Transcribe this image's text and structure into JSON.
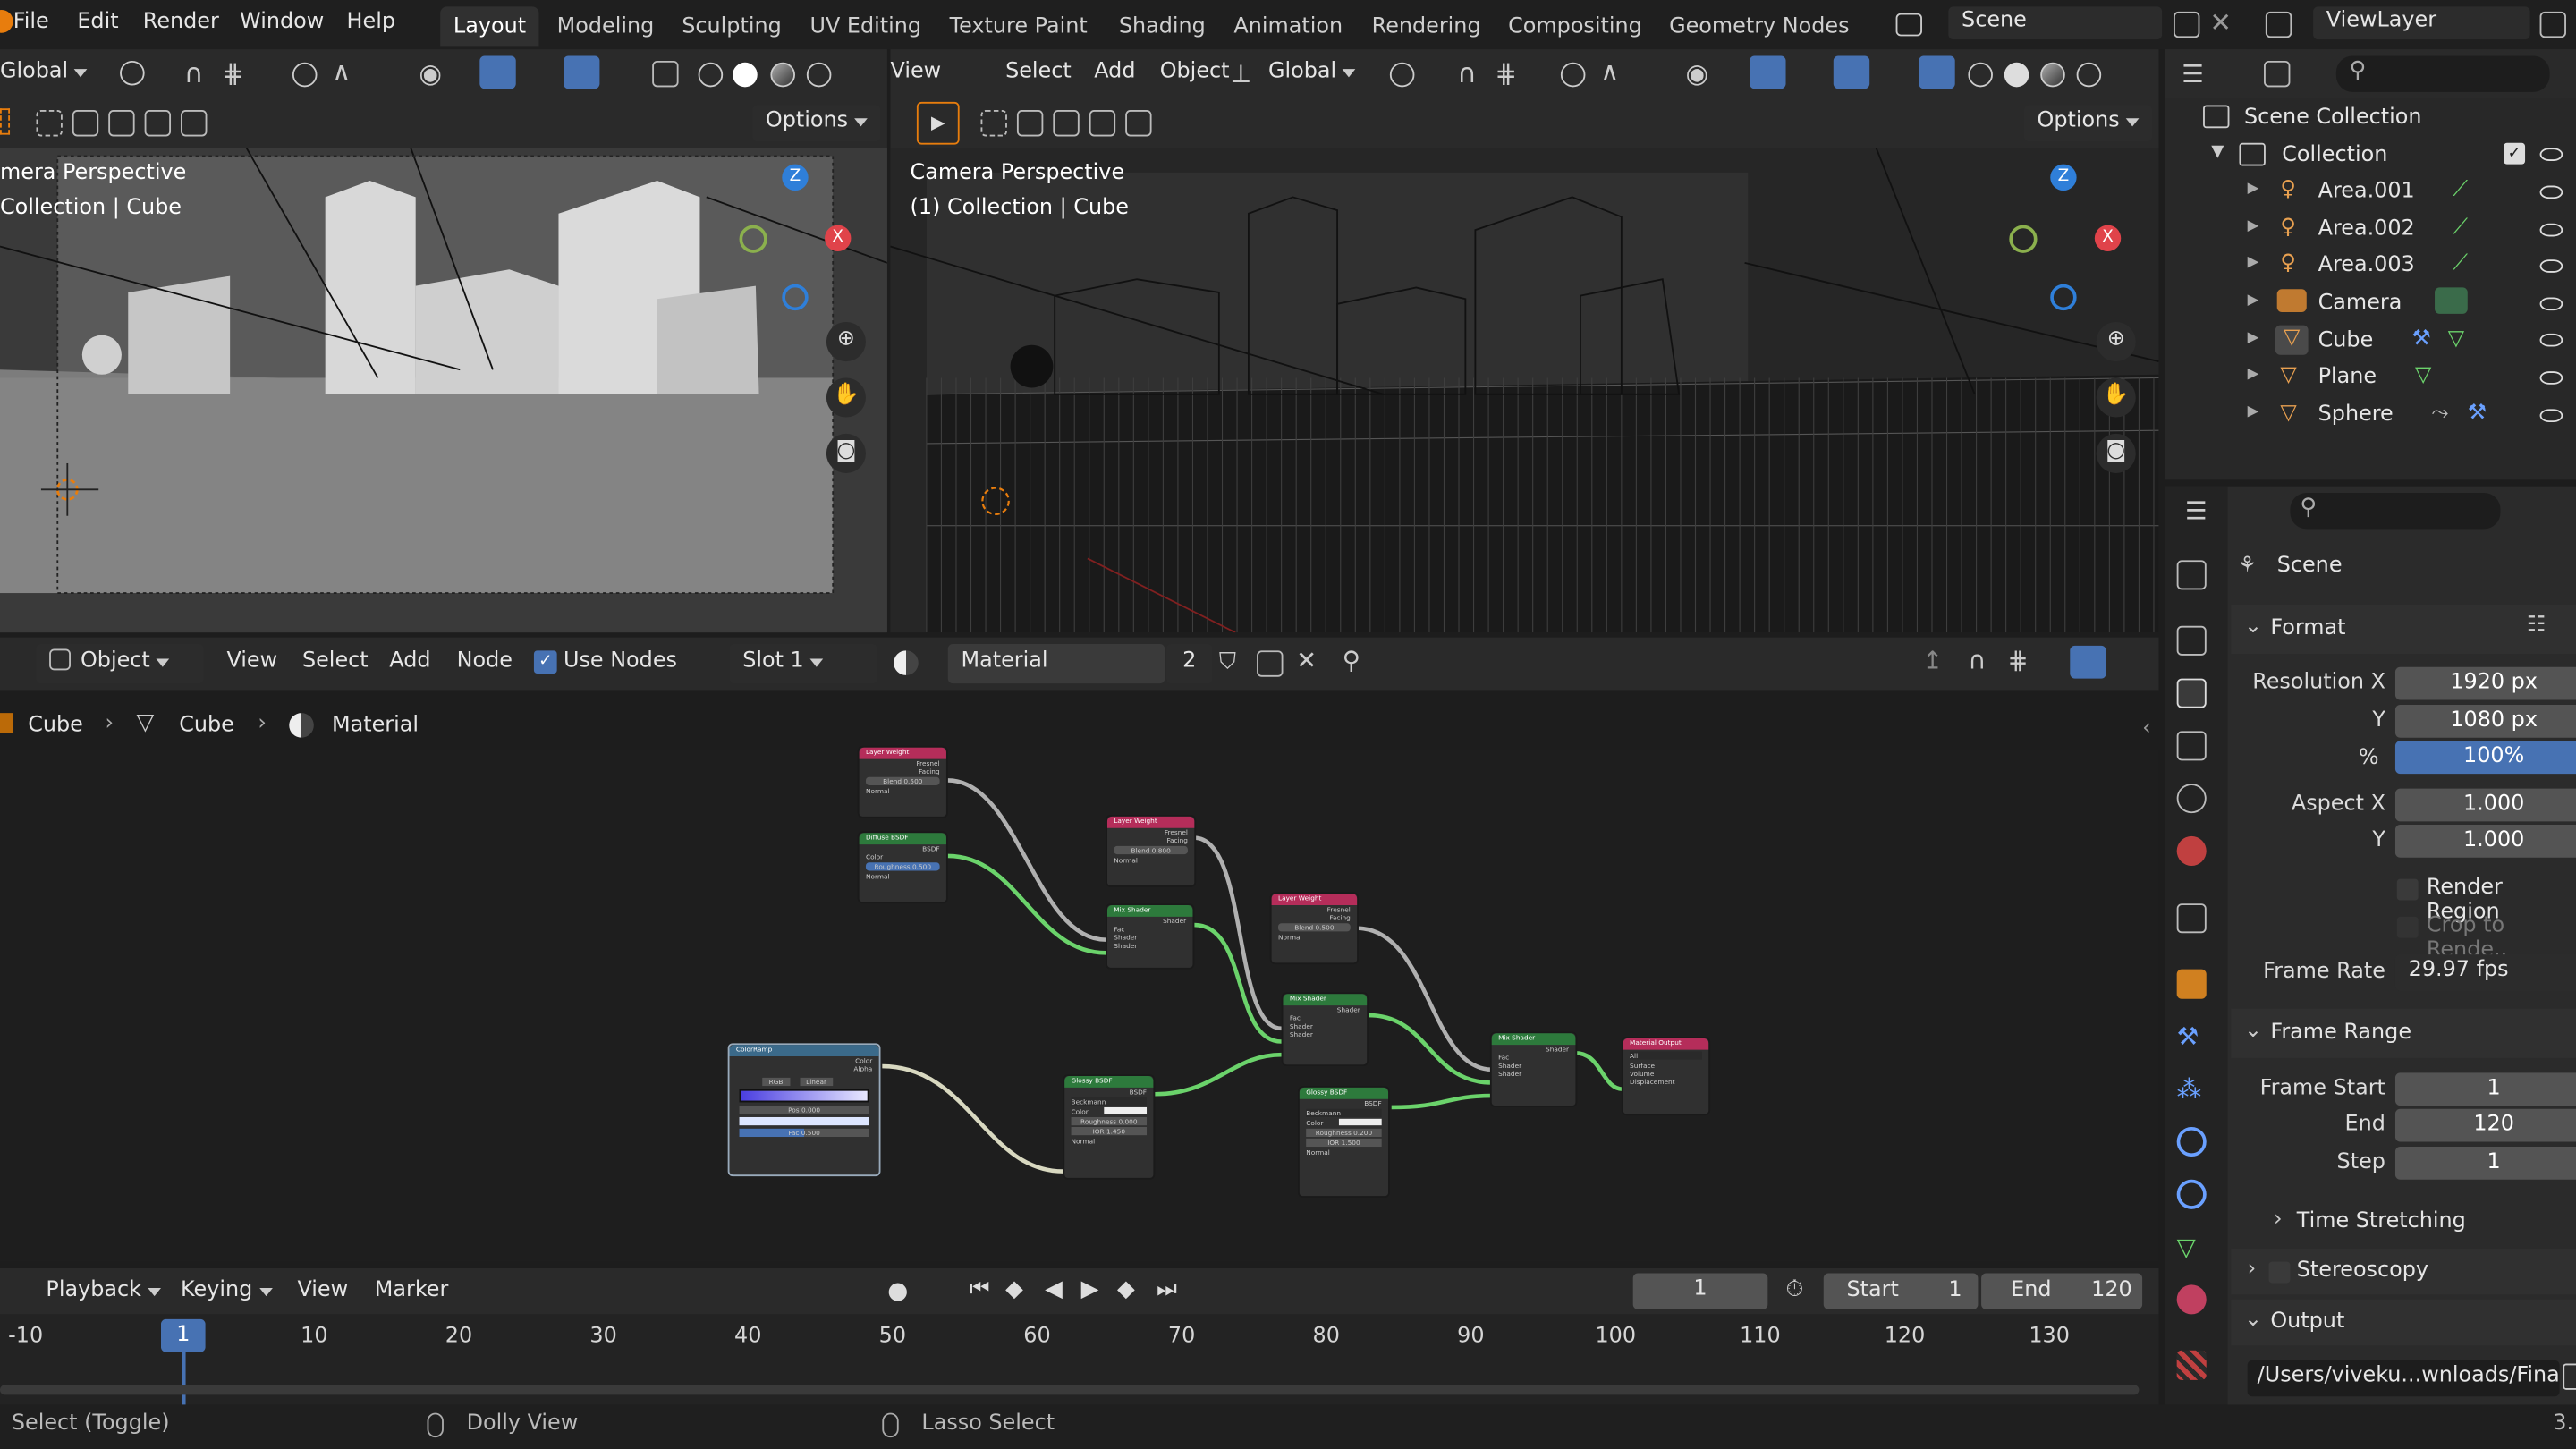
{
  "menus": [
    "File",
    "Edit",
    "Render",
    "Window",
    "Help"
  ],
  "workspaces": [
    "Layout",
    "Modeling",
    "Sculpting",
    "UV Editing",
    "Texture Paint",
    "Shading",
    "Animation",
    "Rendering",
    "Compositing",
    "Geometry Nodes"
  ],
  "scene_name": "Scene",
  "view_layer": "ViewLayer",
  "viewport_left": {
    "orientation": "Global",
    "options_label": "Options",
    "title": "mera Perspective",
    "subtitle": "Collection | Cube"
  },
  "viewport_right": {
    "menu": [
      "View",
      "Select",
      "Add",
      "Object"
    ],
    "orientation": "Global",
    "options_label": "Options",
    "title": "Camera Perspective",
    "subtitle": "(1) Collection | Cube"
  },
  "gizmo": {
    "z": "Z",
    "x": "X",
    "y_color": "#8bb04d",
    "x_color": "#e0434a",
    "z_color": "#2f7fd9"
  },
  "outliner": {
    "root": "Scene Collection",
    "collection": "Collection",
    "items": [
      "Area.001",
      "Area.002",
      "Area.003",
      "Camera",
      "Cube",
      "Plane",
      "Sphere"
    ]
  },
  "node_editor": {
    "mode": "Object",
    "menu": [
      "View",
      "Select",
      "Add",
      "Node"
    ],
    "use_nodes_label": "Use Nodes",
    "slot": "Slot 1",
    "material": "Material",
    "users": "2",
    "breadcrumb": [
      "Cube",
      "Cube",
      "Material"
    ],
    "nodes": {
      "lw1": {
        "title": "Layer Weight",
        "rows": [
          "Fresnel",
          "Facing",
          "Blend 0.500",
          "Normal"
        ]
      },
      "diffuse": {
        "title": "Diffuse BSDF",
        "rows": [
          "BSDF",
          "Color",
          "Roughness 0.500",
          "Normal"
        ]
      },
      "lw2": {
        "title": "Layer Weight",
        "rows": [
          "Fresnel",
          "Facing",
          "Blend 0.800",
          "Normal"
        ]
      },
      "mix1": {
        "title": "Mix Shader",
        "rows": [
          "Shader",
          "Fac",
          "Shader",
          "Shader"
        ]
      },
      "lw3": {
        "title": "Layer Weight",
        "rows": [
          "Fresnel",
          "Facing",
          "Blend 0.500",
          "Normal"
        ]
      },
      "mix2": {
        "title": "Mix Shader",
        "rows": [
          "Shader",
          "Fac",
          "Shader",
          "Shader"
        ]
      },
      "ramp": {
        "title": "ColorRamp",
        "rows": [
          "Color",
          "Alpha",
          "RGB",
          "Linear",
          "Pos 0.000",
          "Fac 0.500"
        ]
      },
      "gloss1": {
        "title": "Glossy BSDF",
        "rows": [
          "BSDF",
          "Beckmann",
          "Color",
          "Roughness 0.000",
          "IOR 1.450",
          "Normal"
        ]
      },
      "gloss2": {
        "title": "Glossy BSDF",
        "rows": [
          "BSDF",
          "Beckmann",
          "Color",
          "Roughness 0.200",
          "IOR 1.500",
          "Normal"
        ]
      },
      "mix3": {
        "title": "Mix Shader",
        "rows": [
          "Shader",
          "Fac",
          "Shader",
          "Shader"
        ]
      },
      "output": {
        "title": "Material Output",
        "rows": [
          "All",
          "Surface",
          "Volume",
          "Displacement"
        ]
      }
    }
  },
  "properties": {
    "context": "Scene",
    "format_label": "Format",
    "resolution_x_label": "Resolution X",
    "resolution_x": "1920 px",
    "y_label": "Y",
    "resolution_y": "1080 px",
    "pct_label": "%",
    "percentage": "100%",
    "aspect_x_label": "Aspect X",
    "aspect_x": "1.000",
    "aspect_y": "1.000",
    "render_region_label": "Render Region",
    "crop_label": "Crop to Rende..",
    "frame_rate_label": "Frame Rate",
    "frame_rate": "29.97 fps",
    "frame_range_label": "Frame Range",
    "frame_start_label": "Frame Start",
    "frame_start": "1",
    "end_label": "End",
    "frame_end": "120",
    "step_label": "Step",
    "step": "1",
    "time_stretching_label": "Time Stretching",
    "stereoscopy_label": "Stereoscopy",
    "output_label": "Output",
    "output_path": "/Users/viveku...wnloads/Final"
  },
  "timeline": {
    "menu": [
      "Playback",
      "Keying",
      "View",
      "Marker"
    ],
    "current_frame": "1",
    "start_label": "Start",
    "start": "1",
    "end_label": "End",
    "end": "120",
    "ticks": [
      "-10",
      "1",
      "10",
      "20",
      "30",
      "40",
      "50",
      "60",
      "70",
      "80",
      "90",
      "100",
      "110",
      "120",
      "130"
    ]
  },
  "status": {
    "left": "Select (Toggle)",
    "middle": "Dolly View",
    "right": "Lasso Select",
    "version": "3."
  },
  "colors": {
    "accent": "#4772b3",
    "node_green": "#6bd36b",
    "node_header_pink": "#b52d5a",
    "node_header_green": "#2d7a3c",
    "node_header_blue": "#3b6a8a"
  }
}
